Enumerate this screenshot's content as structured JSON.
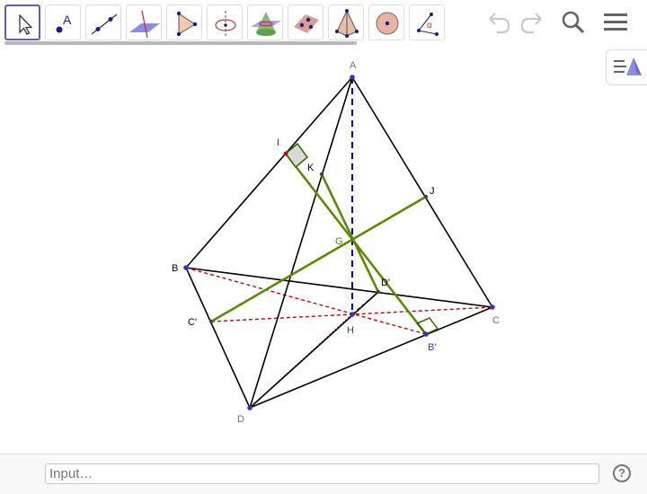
{
  "toolbar": {
    "tools": [
      {
        "name": "move-tool"
      },
      {
        "name": "point-tool",
        "label": "A"
      },
      {
        "name": "line-tool"
      },
      {
        "name": "perpendicular-plane-tool"
      },
      {
        "name": "polygon-tool"
      },
      {
        "name": "circle-axis-tool"
      },
      {
        "name": "intersect-surfaces-tool"
      },
      {
        "name": "plane-through-points-tool"
      },
      {
        "name": "pyramid-tool"
      },
      {
        "name": "sphere-tool"
      },
      {
        "name": "angle-tool",
        "label": "α"
      }
    ],
    "right_icons": [
      "undo-icon",
      "redo-icon",
      "search-icon",
      "menu-icon"
    ]
  },
  "graphics": {
    "point_labels": {
      "A": "A",
      "B": "B",
      "C": "C",
      "D": "D",
      "I": "I",
      "J": "J",
      "K": "K",
      "G": "G",
      "H": "H",
      "Bp": "B'",
      "Cp": "C'",
      "Dp": "D'"
    }
  },
  "input_bar": {
    "placeholder": "Input…",
    "help_label": "?"
  },
  "colors": {
    "active_tool_border": "#6557d2",
    "edge": "#000000",
    "green_segment": "#5b8a00",
    "red_dashed": "#cc0000",
    "blue_dashed": "#0000cc",
    "vertex_blue": "#3333cc",
    "label_blue": "#6666cc",
    "label_red": "#cc0000"
  }
}
